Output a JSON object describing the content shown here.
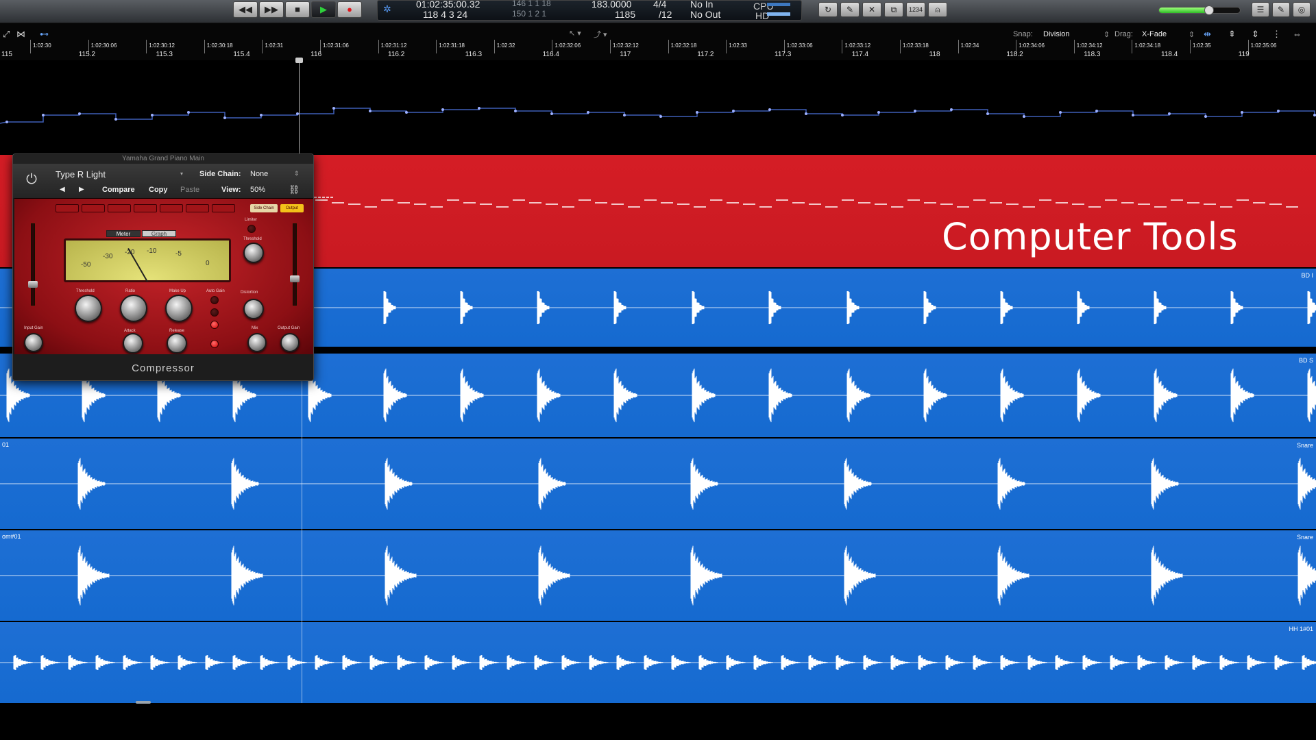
{
  "transport": {
    "rewind": "◀◀",
    "forward": "▶▶",
    "stop": "■",
    "play": "▶",
    "record": "●"
  },
  "lcd": {
    "time": "01:02:35:00.32",
    "bars": "118  4  3    24",
    "tempo_top": "146    1    1    18",
    "tempo_bot": "150    1    2      1",
    "bpm": "183.0000",
    "samples": "1185",
    "sig": "4/4",
    "div": "/12",
    "in": "No In",
    "out": "No Out",
    "cpu": "CPU",
    "hd": "HD"
  },
  "tools": [
    "↻",
    "✎",
    "✕",
    "⧉",
    "1234",
    "⍝"
  ],
  "ruler": {
    "snap_label": "Snap:",
    "snap_value": "Division",
    "drag_label": "Drag:",
    "drag_value": "X-Fade",
    "small_labels": [
      "1:02:30",
      "1:02:30:06",
      "1:02:30:12",
      "1:02:30:18",
      "1:02:31",
      "1:02:31:06",
      "1:02:31:12",
      "1:02:31:18",
      "1:02:32",
      "1:02:32:06",
      "1:02:32:12",
      "1:02:32:18",
      "1:02:33",
      "1:02:33:06",
      "1:02:33:12",
      "1:02:33:18",
      "1:02:34",
      "1:02:34:06",
      "1:02:34:12",
      "1:02:34:18",
      "1:02:35",
      "1:02:35:06"
    ],
    "big_labels": [
      "115",
      "115.2",
      "115.3",
      "115.4",
      "116",
      "116.2",
      "116.3",
      "116.4",
      "117",
      "117.2",
      "117.3",
      "117.4",
      "118",
      "118.2",
      "118.3",
      "118.4",
      "119"
    ]
  },
  "overlay": {
    "title": "Computer Tools"
  },
  "tracks": [
    {
      "label_right": "",
      "label_left": ""
    },
    {
      "label_right": "BD I",
      "label_left": ""
    },
    {
      "label_right": "BD S",
      "label_left": ""
    },
    {
      "label_right": "Snare",
      "label_left": "01"
    },
    {
      "label_right": "Snare",
      "label_left": "om#01"
    },
    {
      "label_right": "HH 1#01",
      "label_left": ""
    }
  ],
  "plugin": {
    "window_title": "Yamaha Grand Piano Main",
    "preset": "Type R Light",
    "side_chain_label": "Side Chain:",
    "side_chain_value": "None",
    "compare": "Compare",
    "copy": "Copy",
    "paste": "Paste",
    "view_label": "View:",
    "view_value": "50%",
    "meter_tab": "Meter",
    "graph_tab": "Graph",
    "vu_scale": [
      "-50",
      "-30",
      "-20",
      "-10",
      "-5",
      "0"
    ],
    "knob_labels": [
      "Threshold",
      "Ratio",
      "Make Up",
      "Auto Gain",
      "Attack",
      "Release",
      "Distortion",
      "Mix",
      "Output Gain",
      "Input Gain",
      "Limiter",
      "Threshold"
    ],
    "side_chain_btn": "Side Chain",
    "output_btn": "Output",
    "name": "Compressor"
  },
  "colors": {
    "red_track": "#d51d25",
    "blue_track": "#1e6fd4",
    "play_green": "#2fd13c",
    "record_red": "#e0161b"
  }
}
